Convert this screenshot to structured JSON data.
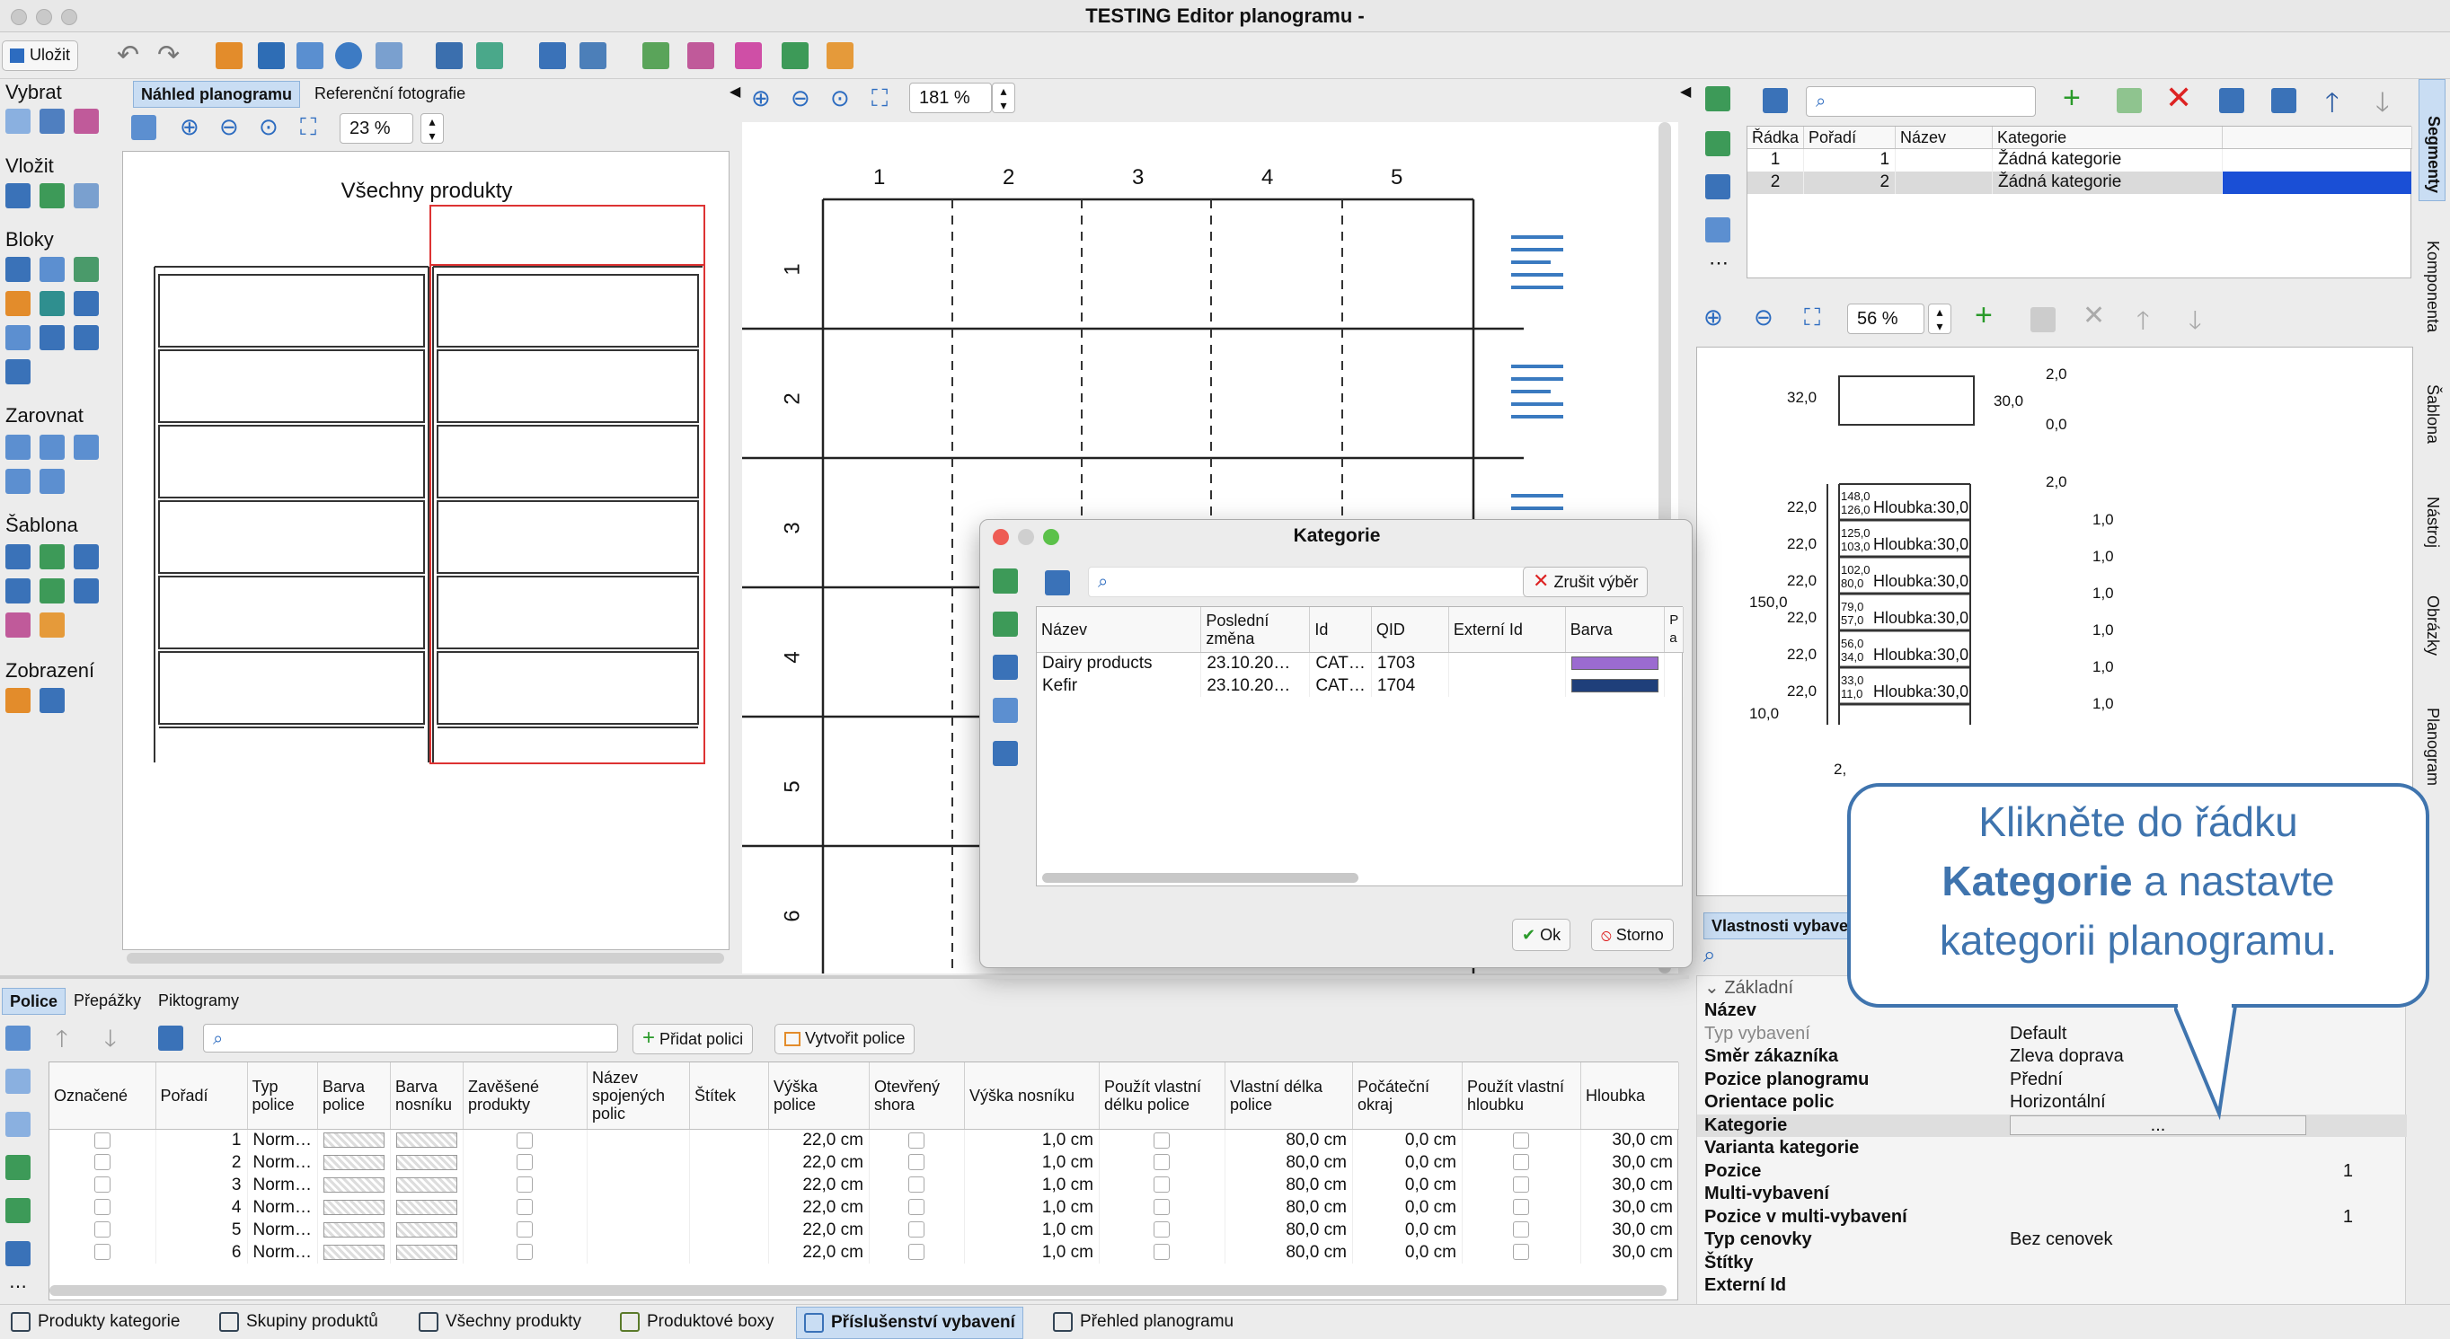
{
  "window": {
    "title": "TESTING Editor planogramu -"
  },
  "toolbar": {
    "save": "Uložit"
  },
  "left_tools": {
    "select": "Vybrat",
    "insert": "Vložit",
    "blocks": "Bloky",
    "align": "Zarovnat",
    "template": "Šablona",
    "view": "Zobrazení"
  },
  "preview": {
    "tab_preview": "Náhled planogramu",
    "tab_reference": "Referenční fotografie",
    "zoom": "23 %",
    "planogram_title": "Všechny produkty"
  },
  "center": {
    "zoom": "181 %",
    "col_labels": [
      "1",
      "2",
      "3",
      "4",
      "5"
    ],
    "row_labels": [
      "1",
      "2",
      "3",
      "4",
      "5",
      "6"
    ]
  },
  "segments": {
    "headers": [
      "Řádka",
      "Pořadí",
      "Název",
      "Kategorie"
    ],
    "rows": [
      {
        "radka": "1",
        "poradi": "1",
        "nazev": "",
        "kategorie": "Žádná kategorie",
        "color": ""
      },
      {
        "radka": "2",
        "poradi": "2",
        "nazev": "",
        "kategorie": "Žádná kategorie",
        "color": "#1a4fd6"
      }
    ],
    "zoom": "56 %"
  },
  "drawing": {
    "top_left_width": "32,0",
    "top_right_a": "2,0",
    "top_right_b": "30,0",
    "top_right_c": "0,0",
    "gap_top": "2,0",
    "total_height": "150,0",
    "base_height": "10,0",
    "bottom_gap": "2,",
    "shelves": [
      {
        "left": "22,0",
        "upper": "148,0",
        "lower": "126,0",
        "label": "Hloubka:30,0",
        "right": "1,0"
      },
      {
        "left": "22,0",
        "upper": "125,0",
        "lower": "103,0",
        "label": "Hloubka:30,0",
        "right": "1,0"
      },
      {
        "left": "22,0",
        "upper": "102,0",
        "lower": "80,0",
        "label": "Hloubka:30,0",
        "right": "1,0"
      },
      {
        "left": "22,0",
        "upper": "79,0",
        "lower": "57,0",
        "label": "Hloubka:30,0",
        "right": "1,0"
      },
      {
        "left": "22,0",
        "upper": "56,0",
        "lower": "34,0",
        "label": "Hloubka:30,0",
        "right": "1,0"
      },
      {
        "left": "22,0",
        "upper": "33,0",
        "lower": "11,0",
        "label": "Hloubka:30,0",
        "right": "1,0"
      }
    ]
  },
  "dialog": {
    "title": "Kategorie",
    "clear_button": "Zrušit výběr",
    "headers": [
      "Název",
      "Poslední změna",
      "Id",
      "QID",
      "Externí Id",
      "Barva",
      "P a"
    ],
    "rows": [
      {
        "name": "Dairy products",
        "changed": "23.10.20…",
        "id": "CAT…",
        "qid": "1703",
        "ext": "",
        "color": "#9b6bd0"
      },
      {
        "name": "Kefir",
        "changed": "23.10.20…",
        "id": "CAT…",
        "qid": "1704",
        "ext": "",
        "color": "#1f3f7a"
      }
    ],
    "ok": "Ok",
    "cancel": "Storno"
  },
  "callout": {
    "line1": "Klikněte do řádku",
    "bold": "Kategorie",
    "line2": " a nastavte",
    "line3": "kategorii planogramu."
  },
  "shelves_panel": {
    "tabs": [
      "Police",
      "Přepážky",
      "Piktogramy"
    ],
    "add_shelf": "Přidat polici",
    "create_shelf": "Vytvořit police",
    "headers": [
      "Označené",
      "Pořadí",
      "Typ police",
      "Barva police",
      "Barva nosníku",
      "Zavěšené produkty",
      "Název spojených polic",
      "Štítek",
      "Výška police",
      "Otevřený shora",
      "Výška nosníku",
      "Použít vlastní délku police",
      "Vlastní délka police",
      "Počáteční okraj",
      "Použít vlastní hloubku",
      "Hloubka"
    ],
    "rows": [
      {
        "order": "1",
        "type": "Norm…",
        "height": "22,0 cm",
        "beam": "1,0 cm",
        "length": "80,0 cm",
        "margin": "0,0 cm",
        "depth": "30,0 cm"
      },
      {
        "order": "2",
        "type": "Norm…",
        "height": "22,0 cm",
        "beam": "1,0 cm",
        "length": "80,0 cm",
        "margin": "0,0 cm",
        "depth": "30,0 cm"
      },
      {
        "order": "3",
        "type": "Norm…",
        "height": "22,0 cm",
        "beam": "1,0 cm",
        "length": "80,0 cm",
        "margin": "0,0 cm",
        "depth": "30,0 cm"
      },
      {
        "order": "4",
        "type": "Norm…",
        "height": "22,0 cm",
        "beam": "1,0 cm",
        "length": "80,0 cm",
        "margin": "0,0 cm",
        "depth": "30,0 cm"
      },
      {
        "order": "5",
        "type": "Norm…",
        "height": "22,0 cm",
        "beam": "1,0 cm",
        "length": "80,0 cm",
        "margin": "0,0 cm",
        "depth": "30,0 cm"
      },
      {
        "order": "6",
        "type": "Norm…",
        "height": "22,0 cm",
        "beam": "1,0 cm",
        "length": "80,0 cm",
        "margin": "0,0 cm",
        "depth": "30,0 cm"
      }
    ]
  },
  "properties": {
    "tab": "Vlastnosti vybave",
    "group": "Základní",
    "rows": [
      {
        "key": "Název",
        "value": "",
        "disabled": false
      },
      {
        "key": "Typ vybavení",
        "value": "Default",
        "disabled": true
      },
      {
        "key": "Směr zákazníka",
        "value": "Zleva doprava",
        "disabled": false
      },
      {
        "key": "Pozice planogramu",
        "value": "Přední",
        "disabled": false
      },
      {
        "key": "Orientace polic",
        "value": "Horizontální",
        "disabled": false
      },
      {
        "key": "Kategorie",
        "value": "...",
        "disabled": false
      },
      {
        "key": "Varianta kategorie",
        "value": "",
        "disabled": false
      },
      {
        "key": "Pozice",
        "value": "1",
        "disabled": false
      },
      {
        "key": "Multi-vybavení",
        "value": "",
        "disabled": false
      },
      {
        "key": "Pozice v multi-vybavení",
        "value": "1",
        "disabled": false
      },
      {
        "key": "Typ cenovky",
        "value": "Bez cenovek",
        "disabled": false
      },
      {
        "key": "Štítky",
        "value": "",
        "disabled": false
      },
      {
        "key": "Externí Id",
        "value": "",
        "disabled": false
      }
    ]
  },
  "side_tabs": [
    "Segmenty",
    "Komponenta",
    "Šablona",
    "Nástroj",
    "Obrázky",
    "Planogram"
  ],
  "bottom_tabs": [
    "Produkty kategorie",
    "Skupiny produktů",
    "Všechny produkty",
    "Produktové boxy",
    "Příslušenství vybavení",
    "Přehled planogramu"
  ]
}
